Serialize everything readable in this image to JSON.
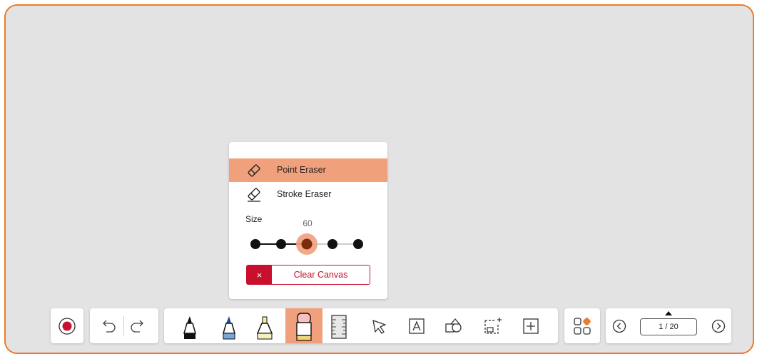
{
  "eraser_menu": {
    "point_eraser_label": "Point Eraser",
    "stroke_eraser_label": "Stroke Eraser",
    "size_label": "Size",
    "size_value": "60",
    "selected_size_index": 2,
    "clear_canvas_label": "Clear Canvas",
    "clear_icon": "×"
  },
  "pagination": {
    "page_indicator": "1 / 20"
  },
  "toolbar": {
    "tools": [
      "record-icon",
      "undo-icon",
      "redo-icon",
      "pen-black-icon",
      "pen-blue-icon",
      "highlighter-icon",
      "eraser-icon",
      "ruler-icon",
      "select-arrow-icon",
      "text-tool-icon",
      "shapes-icon",
      "add-image-icon",
      "add-element-icon",
      "apps-icon",
      "prev-page-icon",
      "next-page-icon"
    ],
    "active_tool": "eraser-icon"
  },
  "colors": {
    "accent": "#ee7a2b",
    "active_highlight": "#f1a07c",
    "danger": "#c8102e",
    "canvas_bg": "#e3e3e3"
  }
}
